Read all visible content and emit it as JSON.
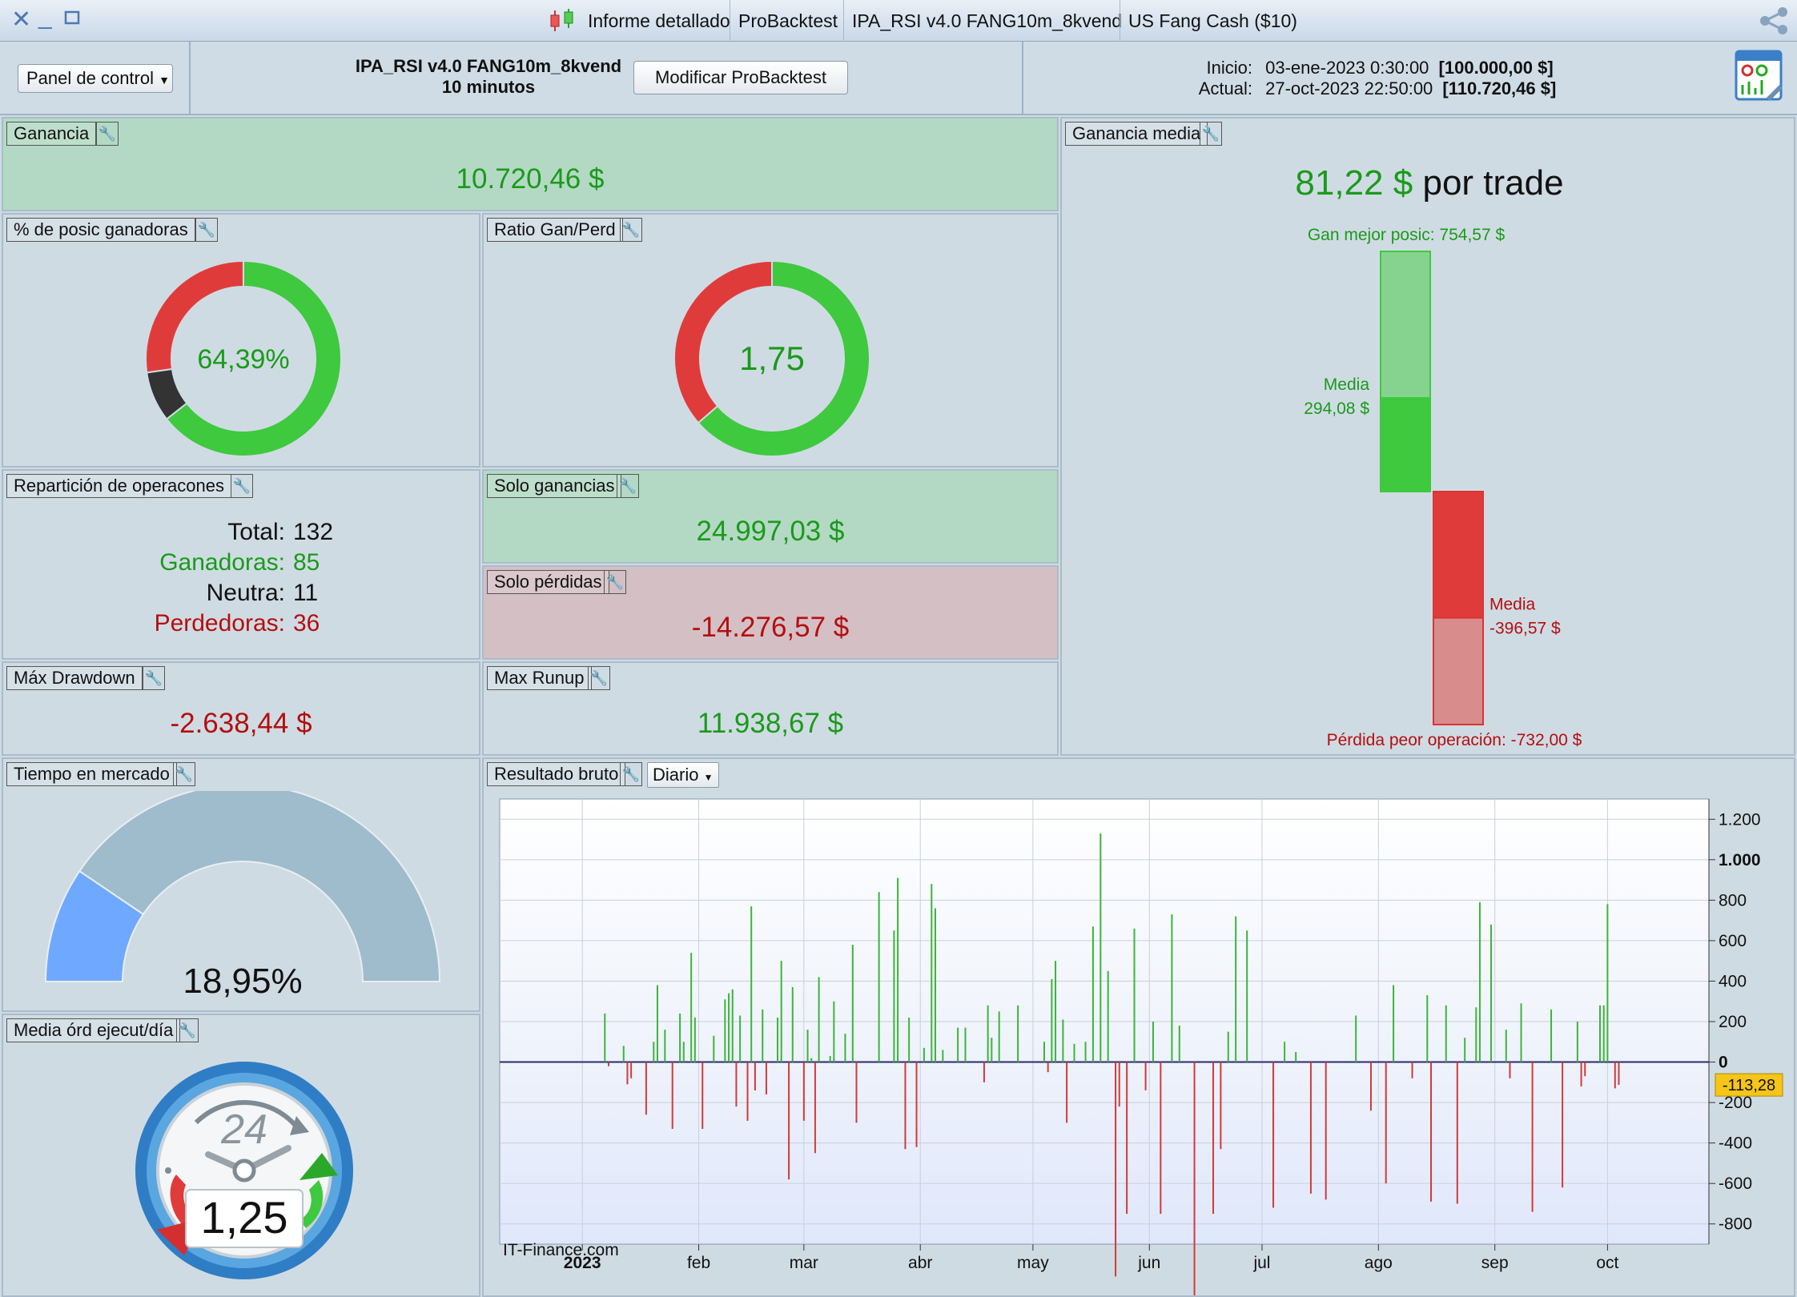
{
  "titlebar": {
    "report_label": "Informe detallado",
    "tabs": [
      "ProBacktest",
      "IPA_RSI v4.0 FANG10m_8kvend",
      "US Fang Cash ($10)"
    ]
  },
  "header": {
    "panel_control": "Panel de control",
    "strategy_name": "IPA_RSI v4.0 FANG10m_8kvend",
    "timeframe": "10 minutos",
    "modify_button": "Modificar ProBacktest",
    "start_label": "Inicio:",
    "start_date": "03-ene-2023 0:30:00",
    "start_value": "[100.000,00 $]",
    "current_label": "Actual:",
    "current_date": "27-oct-2023 22:50:00",
    "current_value": "[110.720,46 $]"
  },
  "ganancia": {
    "title": "Ganancia",
    "value": "10.720,46 $"
  },
  "winners_pct": {
    "title": "% de posic ganadoras",
    "value": "64,39%",
    "fractions": {
      "win": 0.6439,
      "neutral": 0.0833,
      "loss": 0.2727
    }
  },
  "ratio": {
    "title": "Ratio Gan/Perd",
    "value": "1,75",
    "win_fraction": 0.636
  },
  "reparticion": {
    "title": "Repartición de operacones",
    "total_label": "Total:",
    "total": "132",
    "win_label": "Ganadoras:",
    "win": "85",
    "neutral_label": "Neutra:",
    "neutral": "11",
    "loss_label": "Perdedoras:",
    "loss": "36"
  },
  "solo_ganancias": {
    "title": "Solo ganancias",
    "value": "24.997,03 $"
  },
  "solo_perdidas": {
    "title": "Solo pérdidas",
    "value": "-14.276,57 $"
  },
  "drawdown": {
    "title": "Máx Drawdown",
    "value": "-2.638,44 $"
  },
  "runup": {
    "title": "Max Runup",
    "value": "11.938,67 $"
  },
  "ganancia_media": {
    "title": "Ganancia media",
    "value": "81,22 $",
    "suffix": "por trade",
    "best_label": "Gan mejor posic: 754,57 $",
    "media_label": "Media",
    "media_pos": "294,08 $",
    "media_neg": "-396,57 $",
    "worst_label": "Pérdida peor operación: -732,00 $",
    "best": 754.57,
    "avg_win": 294.08,
    "avg_loss": -396.57,
    "worst": -732.0
  },
  "tiempo": {
    "title": "Tiempo en mercado",
    "value": "18,95%",
    "fraction": 0.1895
  },
  "media_ord": {
    "title": "Media órd ejecut/día",
    "value": "1,25",
    "clock_label": "24"
  },
  "resultado": {
    "title": "Resultado bruto",
    "period": "Diario",
    "watermark": "IT-Finance.com",
    "last_value": "-113,28"
  },
  "colors": {
    "green": "#1a9a1a",
    "red": "#b30f0f",
    "donut_green": "#3ec93e",
    "donut_red": "#e03b3b",
    "donut_dark": "#333333"
  },
  "chart_data": {
    "type": "bar",
    "title": "",
    "xlabel": "",
    "ylabel": "",
    "ylim": [
      -900,
      1300
    ],
    "yticks": [
      1200,
      1000,
      800,
      600,
      400,
      200,
      0,
      -200,
      -400,
      -600,
      -800
    ],
    "ytick_labels": [
      "1.200",
      "1.000",
      "800",
      "600",
      "400",
      "200",
      "0",
      "-200",
      "-400",
      "-600",
      "-800"
    ],
    "x_tick_labels": [
      "2023",
      "feb",
      "mar",
      "abr",
      "may",
      "jun",
      "jul",
      "ago",
      "sep",
      "oct"
    ],
    "x_tick_pos": [
      0,
      31,
      59,
      90,
      120,
      151,
      181,
      212,
      243,
      273
    ],
    "x_range": [
      -22,
      300
    ],
    "x_unit": "days since 2023-01-01",
    "x": [
      6,
      7,
      11,
      12,
      13,
      17,
      19,
      20,
      22,
      24,
      26,
      27,
      29,
      30,
      32,
      35,
      38,
      39,
      40,
      41,
      42,
      44,
      45,
      46,
      48,
      49,
      52,
      53,
      55,
      56,
      59,
      60,
      61,
      62,
      63,
      66,
      67,
      70,
      72,
      73,
      79,
      83,
      84,
      86,
      87,
      89,
      91,
      93,
      94,
      96,
      100,
      102,
      107,
      108,
      109,
      111,
      116,
      123,
      124,
      125,
      126,
      128,
      129,
      131,
      134,
      136,
      138,
      140,
      142,
      143,
      145,
      147,
      150,
      152,
      154,
      157,
      159,
      163,
      168,
      170,
      172,
      174,
      177,
      184,
      187,
      190,
      194,
      198,
      206,
      210,
      214,
      216,
      221,
      225,
      226,
      230,
      233,
      235,
      238,
      239,
      242,
      246,
      247,
      250,
      253,
      258,
      261,
      265,
      266,
      267,
      271,
      272,
      273,
      275,
      276
    ],
    "values": [
      240,
      -20,
      80,
      -110,
      -80,
      -260,
      100,
      380,
      160,
      -330,
      240,
      100,
      540,
      220,
      -330,
      130,
      310,
      340,
      360,
      -220,
      230,
      -290,
      770,
      -140,
      260,
      -160,
      220,
      500,
      -580,
      370,
      -290,
      160,
      20,
      -450,
      420,
      30,
      300,
      140,
      580,
      -300,
      840,
      650,
      910,
      -430,
      220,
      -420,
      70,
      880,
      760,
      60,
      170,
      170,
      -100,
      280,
      120,
      250,
      280,
      100,
      -50,
      410,
      500,
      210,
      -300,
      90,
      100,
      670,
      1130,
      450,
      -1060,
      -220,
      -750,
      660,
      -140,
      200,
      -750,
      730,
      180,
      -1280,
      -750,
      -430,
      150,
      720,
      650,
      -720,
      100,
      50,
      -650,
      -680,
      230,
      -240,
      -600,
      380,
      -80,
      330,
      -690,
      280,
      -700,
      120,
      270,
      790,
      680,
      160,
      -80,
      290,
      -740,
      260,
      -620,
      200,
      -120,
      -70,
      280,
      280,
      780,
      -130,
      -113
    ]
  }
}
